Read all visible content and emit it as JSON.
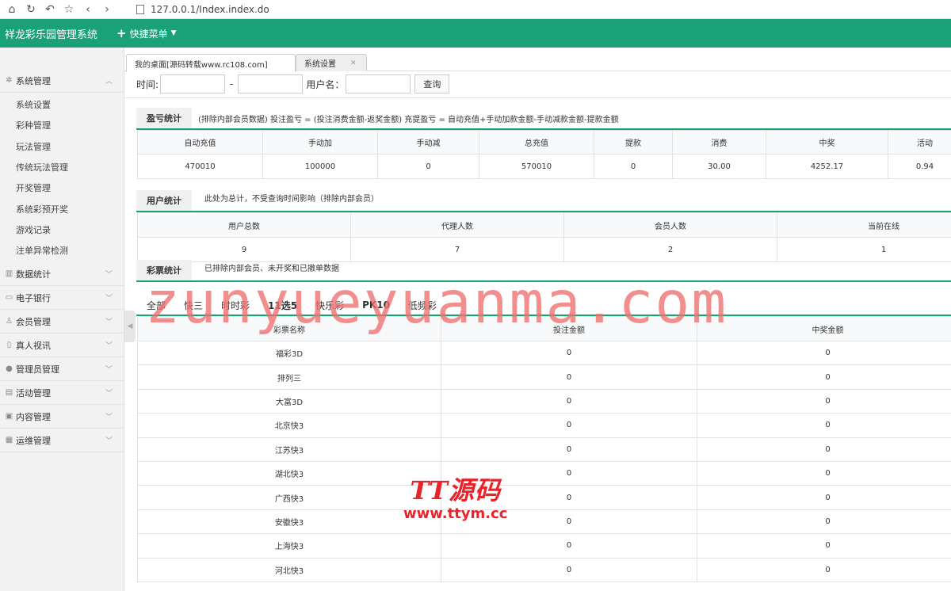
{
  "browser": {
    "url": "127.0.0.1/Index.index.do"
  },
  "app": {
    "title": "祥龙彩乐园管理系统",
    "quick_menu": "快捷菜单"
  },
  "sidebar": {
    "groups": [
      {
        "label": "系统管理",
        "icon": "gear-icon",
        "expanded": true,
        "items": [
          "系统设置",
          "彩种管理",
          "玩法管理",
          "传统玩法管理",
          "开奖管理",
          "系统彩预开奖",
          "游戏记录",
          "注单异常检测"
        ]
      },
      {
        "label": "数据统计",
        "icon": "chart-icon"
      },
      {
        "label": "电子银行",
        "icon": "card-icon"
      },
      {
        "label": "会员管理",
        "icon": "user-icon"
      },
      {
        "label": "真人视讯",
        "icon": "video-icon"
      },
      {
        "label": "管理员管理",
        "icon": "admin-icon"
      },
      {
        "label": "活动管理",
        "icon": "gift-icon"
      },
      {
        "label": "内容管理",
        "icon": "content-icon"
      },
      {
        "label": "运维管理",
        "icon": "tools-icon"
      }
    ]
  },
  "tabs": [
    {
      "label": "我的桌面[源码转载www.rc108.com]",
      "active": true
    },
    {
      "label": "系统设置",
      "active": false
    }
  ],
  "search": {
    "time_label": "时间:",
    "separator": "-",
    "username_label": "用户名：",
    "button": "查询"
  },
  "profit": {
    "title": "盈亏统计",
    "note": "(排除内部会员数据)  投注盈亏 = (投注消费金额-返奖金额)     充提盈亏 = 自动充值+手动加款金额-手动减款金额-提款金额",
    "headers": [
      "自动充值",
      "手动加",
      "手动减",
      "总充值",
      "提款",
      "消费",
      "中奖",
      "活动"
    ],
    "values": [
      "470010",
      "100000",
      "0",
      "570010",
      "0",
      "30.00",
      "4252.17",
      "0.94"
    ]
  },
  "users": {
    "title": "用户统计",
    "note": "此处为总计，不受查询时间影响（排除内部会员）",
    "headers": [
      "用户总数",
      "代理人数",
      "会员人数",
      "当前在线"
    ],
    "values": [
      "9",
      "7",
      "2",
      "1"
    ]
  },
  "lottery": {
    "title": "彩票统计",
    "note": "已排除内部会员、未开奖和已撤单数据",
    "tabs": [
      "全部",
      "快三",
      "时时彩",
      "11选5",
      "快乐彩",
      "PK10",
      "低频彩"
    ],
    "headers": [
      "彩票名称",
      "投注金额",
      "中奖金额"
    ],
    "rows": [
      [
        "福彩3D",
        "0",
        "0"
      ],
      [
        "排列三",
        "0",
        "0"
      ],
      [
        "大富3D",
        "0",
        "0"
      ],
      [
        "北京快3",
        "0",
        "0"
      ],
      [
        "江苏快3",
        "0",
        "0"
      ],
      [
        "湖北快3",
        "0",
        "0"
      ],
      [
        "广西快3",
        "0",
        "0"
      ],
      [
        "安徽快3",
        "0",
        "0"
      ],
      [
        "上海快3",
        "0",
        "0"
      ],
      [
        "河北快3",
        "0",
        "0"
      ]
    ]
  },
  "watermarks": {
    "main": "zunyueyuanma.com",
    "logo": "TT源码",
    "site": "www.ttym.cc"
  }
}
